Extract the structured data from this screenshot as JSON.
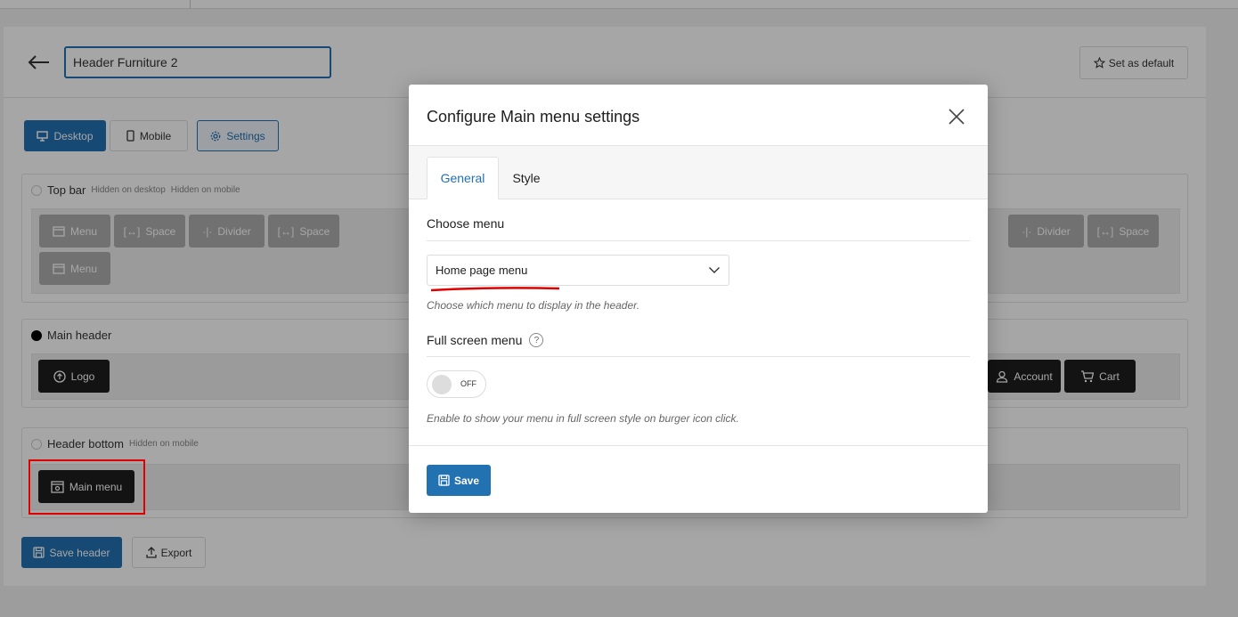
{
  "editor": {
    "header_name_value": "Header Furniture 2",
    "set_default_label": "Set as default",
    "device_tabs": {
      "desktop": "Desktop",
      "mobile": "Mobile",
      "settings": "Settings"
    },
    "top_bar": {
      "title": "Top bar",
      "hidden_desktop": "Hidden on desktop",
      "hidden_mobile": "Hidden on mobile",
      "items_left": [
        "Menu",
        "Space",
        "Divider",
        "Space"
      ],
      "items_left_row2": [
        "Menu"
      ],
      "items_right": [
        "Divider",
        "Space"
      ]
    },
    "main_header": {
      "title": "Main header",
      "logo_label": "Logo",
      "account_label": "Account",
      "cart_label": "Cart"
    },
    "header_bottom": {
      "title": "Header bottom",
      "hidden_mobile": "Hidden on mobile",
      "main_menu_label": "Main menu"
    },
    "save_header_label": "Save header",
    "export_label": "Export"
  },
  "modal": {
    "title": "Configure Main menu settings",
    "tabs": [
      "General",
      "Style"
    ],
    "choose_menu_label": "Choose menu",
    "menu_selected": "Home page menu",
    "menu_help": "Choose which menu to display in the header.",
    "full_screen_label": "Full screen menu",
    "help_glyph": "?",
    "toggle_state": "OFF",
    "full_screen_help": "Enable to show your menu in full screen style on burger icon click.",
    "save_label": "Save"
  },
  "colors": {
    "accent": "#2271b1",
    "annotation_red": "#e00000"
  }
}
